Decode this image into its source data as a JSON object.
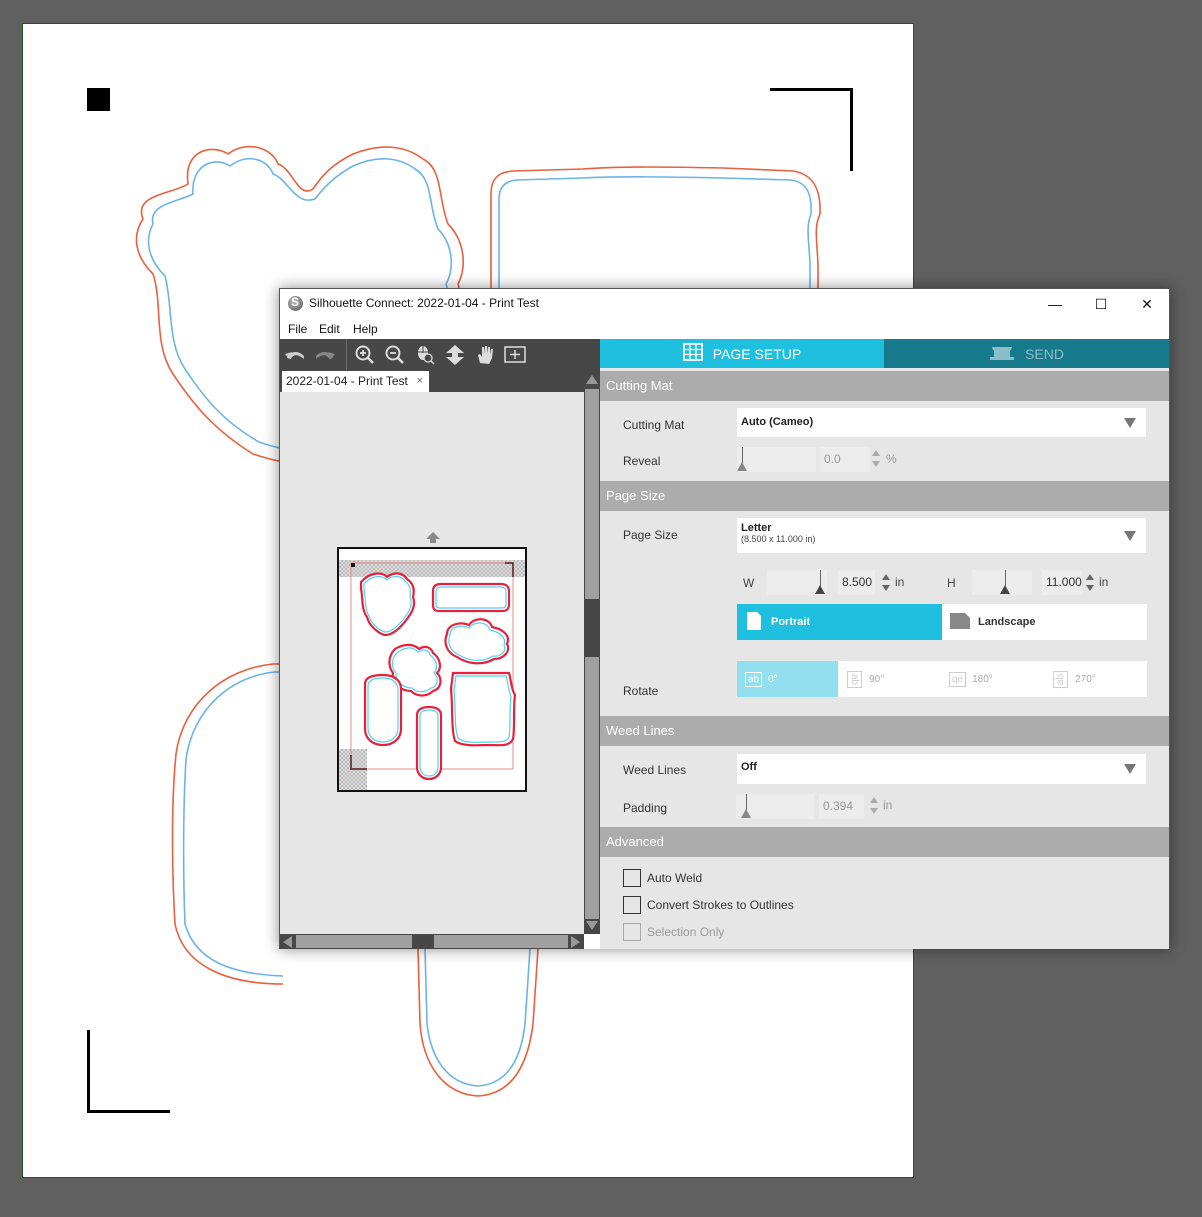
{
  "window": {
    "title": "Silhouette Connect: 2022-01-04 - Print Test",
    "controls": {
      "minimize": "—",
      "maximize": "☐",
      "close": "✕"
    }
  },
  "menu": [
    "File",
    "Edit",
    "Help"
  ],
  "toolbar": {
    "buttons": [
      "undo-icon",
      "redo-icon",
      "zoom-in-icon",
      "zoom-out-icon",
      "zoom-to-selection-icon",
      "fit-to-page-icon",
      "pan-hand-icon",
      "zoom-box-icon"
    ]
  },
  "document_tab": {
    "label": "2022-01-04 - Print Test",
    "close": "×"
  },
  "tabs": {
    "page_setup": "PAGE SETUP",
    "send": "SEND",
    "active": "PAGE SETUP"
  },
  "sections": {
    "cutting_mat": {
      "header": "Cutting Mat",
      "cutting_mat_label": "Cutting Mat",
      "cutting_mat_value": "Auto (Cameo)",
      "reveal_label": "Reveal",
      "reveal_value": "0.0",
      "reveal_unit": "%"
    },
    "page_size": {
      "header": "Page Size",
      "page_size_label": "Page Size",
      "page_size_value": "Letter",
      "page_size_sub": "(8.500 x 11.000 in)",
      "w_label": "W",
      "w_value": "8.500",
      "w_unit": "in",
      "h_label": "H",
      "h_value": "11.000",
      "h_unit": "in",
      "portrait": "Portrait",
      "landscape": "Landscape",
      "orientation_selected": "Portrait",
      "rotate_label": "Rotate",
      "rotate_options": [
        "0°",
        "90°",
        "180°",
        "270°"
      ],
      "rotate_icons": [
        "ab",
        "ab",
        "qe",
        "ab"
      ],
      "rotate_selected": "0°"
    },
    "weed_lines": {
      "header": "Weed Lines",
      "weed_lines_label": "Weed Lines",
      "weed_lines_value": "Off",
      "padding_label": "Padding",
      "padding_value": "0.394",
      "padding_unit": "in"
    },
    "advanced": {
      "header": "Advanced",
      "auto_weld": "Auto Weld",
      "convert_strokes": "Convert Strokes to Outlines",
      "selection_only": "Selection Only",
      "auto_weld_checked": false,
      "convert_strokes_checked": false,
      "selection_only_checked": false,
      "selection_only_enabled": false
    }
  },
  "colors": {
    "accent": "#1fbfdf",
    "send_tab": "#177a8c",
    "section_header": "#acacac",
    "cut_outline": "#e8603c",
    "print_outline": "#6ab4e8"
  }
}
